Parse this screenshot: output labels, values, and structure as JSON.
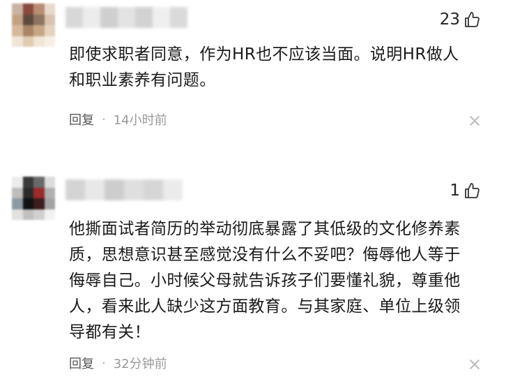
{
  "comments": [
    {
      "likes": "23",
      "text_lines": [
        "即使求职者同意，作为HR也不应该当面。说明HR做人",
        "和职业素养有问题。"
      ],
      "reply_label": "回复",
      "separator": "·",
      "time": "14小时前"
    },
    {
      "likes": "1",
      "text_lines": [
        "他撕面试者简历的举动彻底暴露了其低级的文化修养素",
        "质，思想意识甚至感觉没有什么不妥吧？侮辱他人等于",
        "侮辱自己。小时候父母就告诉孩子们要懂礼貌，尊重他",
        "人，看来此人缺少这方面教育。与其家庭、单位上级领",
        "导都有关！"
      ],
      "reply_label": "回复",
      "separator": "·",
      "time": "32分钟前"
    }
  ],
  "icons": {
    "like": "thumbs-up-icon",
    "close": "close-icon"
  }
}
